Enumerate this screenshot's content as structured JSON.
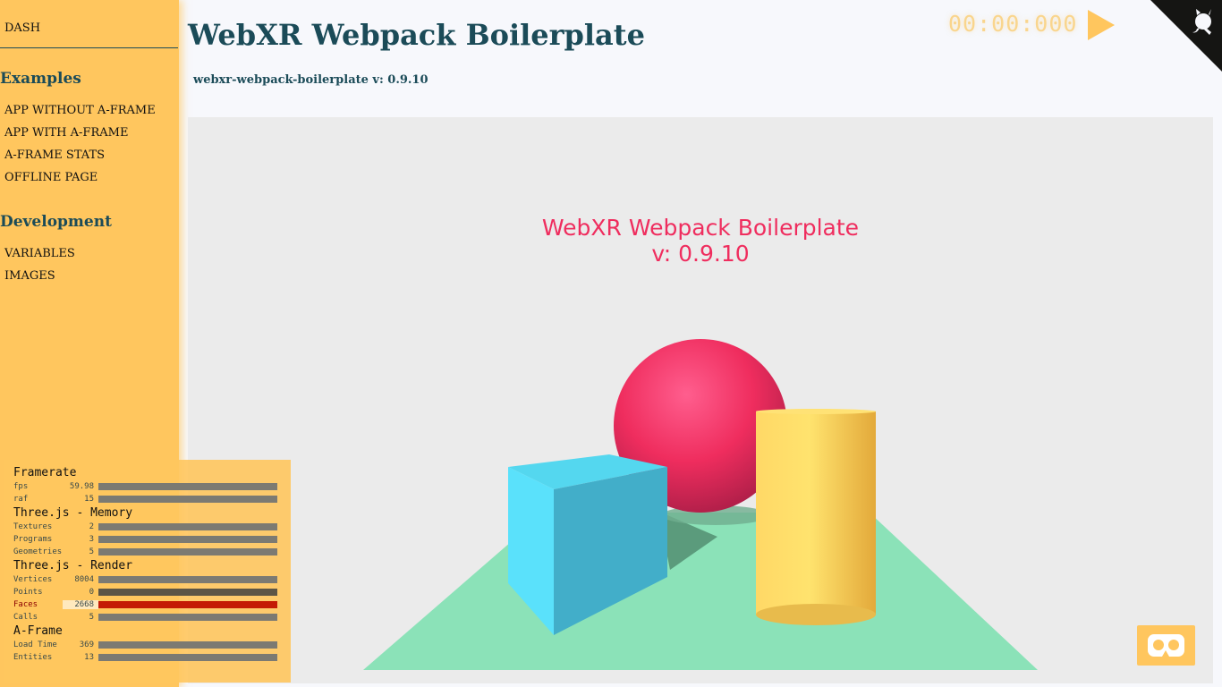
{
  "sidebar": {
    "dash_label": "DASH",
    "sections": [
      {
        "heading": "Examples",
        "items": [
          "APP WITHOUT A-FRAME",
          "APP WITH A-FRAME",
          "A-FRAME STATS",
          "OFFLINE PAGE"
        ]
      },
      {
        "heading": "Development",
        "items": [
          "VARIABLES",
          "IMAGES"
        ]
      }
    ]
  },
  "header": {
    "title": "WebXR Webpack Boilerplate",
    "subtitle": "webxr-webpack-boilerplate v: 0.9.10",
    "timer": "00:00:000",
    "play_icon": "play-icon",
    "corner_icon": "github-octocat-icon"
  },
  "scene": {
    "text_line1": "WebXR Webpack Boilerplate",
    "text_line2": "v: 0.9.10",
    "colors": {
      "background": "#ebebeb",
      "sphere": "#ef2d5e",
      "box": "#4cc3d9",
      "cylinder": "#ffc65d",
      "plane": "#7bc8a4"
    }
  },
  "vr_button": {
    "icon": "vr-headset-icon"
  },
  "stats": {
    "groups": [
      {
        "title": "Framerate",
        "rows": [
          {
            "label": "fps",
            "value": "59.98"
          },
          {
            "label": "raf",
            "value": "15"
          }
        ]
      },
      {
        "title": "Three.js - Memory",
        "rows": [
          {
            "label": "Textures",
            "value": "2"
          },
          {
            "label": "Programs",
            "value": "3"
          },
          {
            "label": "Geometries",
            "value": "5"
          }
        ]
      },
      {
        "title": "Three.js - Render",
        "rows": [
          {
            "label": "Vertices",
            "value": "8004"
          },
          {
            "label": "Points",
            "value": "0"
          },
          {
            "label": "Faces",
            "value": "2668"
          },
          {
            "label": "Calls",
            "value": "5"
          }
        ]
      },
      {
        "title": "A-Frame",
        "rows": [
          {
            "label": "Load Time",
            "value": "369"
          },
          {
            "label": "Entities",
            "value": "13"
          }
        ]
      }
    ]
  }
}
